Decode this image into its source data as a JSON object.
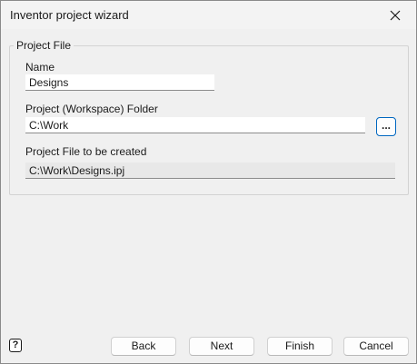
{
  "window": {
    "title": "Inventor project wizard"
  },
  "group": {
    "title": "Project File",
    "name_label": "Name",
    "name_value": "Designs",
    "folder_label": "Project (Workspace) Folder",
    "folder_value": "C:\\Work",
    "browse_label": "...",
    "file_label": "Project File to be created",
    "file_value": "C:\\Work\\Designs.ipj"
  },
  "buttons": {
    "back": "Back",
    "next": "Next",
    "finish": "Finish",
    "cancel": "Cancel"
  },
  "help_icon": "question-icon",
  "colors": {
    "accent": "#0067c0",
    "background": "#f0f0f0"
  }
}
